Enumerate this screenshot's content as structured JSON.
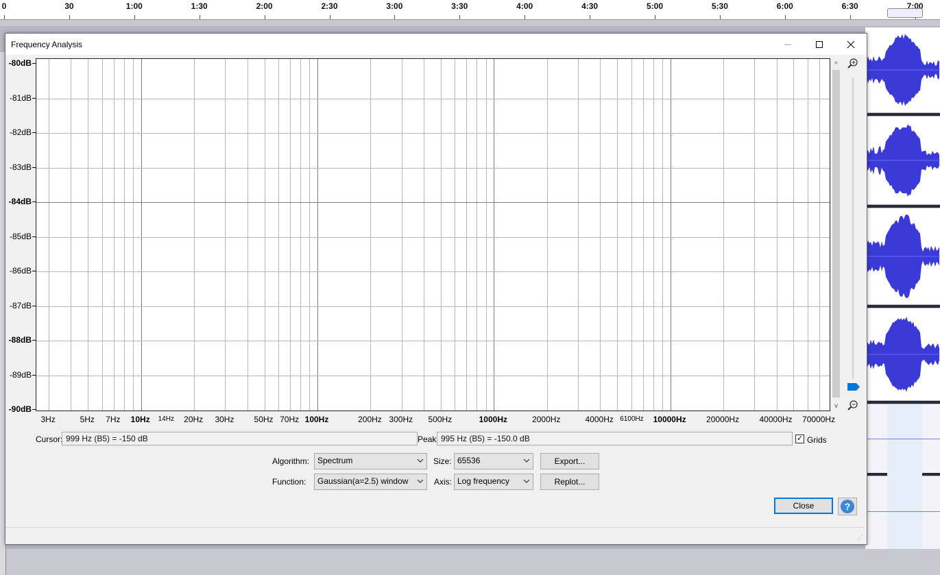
{
  "timeline": {
    "ticks": [
      "0",
      "30",
      "1:00",
      "1:30",
      "2:00",
      "2:30",
      "3:00",
      "3:30",
      "4:00",
      "4:30",
      "5:00",
      "5:30",
      "6:00",
      "6:30",
      "7:00"
    ]
  },
  "dialog": {
    "title": "Frequency Analysis",
    "window_controls": {
      "minimize": "—",
      "maximize": "☐",
      "close": "✕"
    }
  },
  "chart_data": {
    "type": "line",
    "title": "",
    "xlabel": "",
    "ylabel": "",
    "x_scale": "log",
    "xlim": [
      3,
      80000
    ],
    "ylim": [
      -90,
      -80
    ],
    "grid": true,
    "series": [],
    "y_ticks": [
      "-80dB",
      "-81dB",
      "-82dB",
      "-83dB",
      "-84dB",
      "-85dB",
      "-86dB",
      "-87dB",
      "-88dB",
      "-89dB",
      "-90dB"
    ],
    "x_tick_labels": [
      {
        "text": "3Hz",
        "value": 3
      },
      {
        "text": "5Hz",
        "value": 5
      },
      {
        "text": "7Hz",
        "value": 7
      },
      {
        "text": "10Hz",
        "value": 10,
        "major": true
      },
      {
        "text": "14Hz",
        "value": 14,
        "small": true
      },
      {
        "text": "20Hz",
        "value": 20
      },
      {
        "text": "30Hz",
        "value": 30
      },
      {
        "text": "50Hz",
        "value": 50
      },
      {
        "text": "70Hz",
        "value": 70
      },
      {
        "text": "100Hz",
        "value": 100,
        "major": true
      },
      {
        "text": "200Hz",
        "value": 200
      },
      {
        "text": "300Hz",
        "value": 300
      },
      {
        "text": "500Hz",
        "value": 500
      },
      {
        "text": "1000Hz",
        "value": 1000,
        "major": true
      },
      {
        "text": "2000Hz",
        "value": 2000
      },
      {
        "text": "4000Hz",
        "value": 4000
      },
      {
        "text": "6100Hz",
        "value": 6100,
        "small": true
      },
      {
        "text": "10000Hz",
        "value": 10000,
        "major": true
      },
      {
        "text": "20000Hz",
        "value": 20000
      },
      {
        "text": "40000Hz",
        "value": 40000
      },
      {
        "text": "70000Hz",
        "value": 70000
      }
    ]
  },
  "readouts": {
    "cursor_label": "Cursor:",
    "cursor_value": "999 Hz (B5) = -150 dB",
    "peak_label": "Peak:",
    "peak_value": "995 Hz (B5) = -150.0 dB",
    "grids_label": "Grids",
    "grids_checked": true
  },
  "controls": {
    "algorithm_label": "Algorithm:",
    "algorithm_value": "Spectrum",
    "function_label": "Function:",
    "function_value": "Gaussian(a=2.5) window",
    "size_label": "Size:",
    "size_value": "65536",
    "axis_label": "Axis:",
    "axis_value": "Log frequency",
    "export_label": "Export...",
    "replot_label": "Replot...",
    "close_label": "Close",
    "help_label": "?"
  },
  "colors": {
    "waveform": "#3a3ad6",
    "accent": "#0078d7"
  }
}
